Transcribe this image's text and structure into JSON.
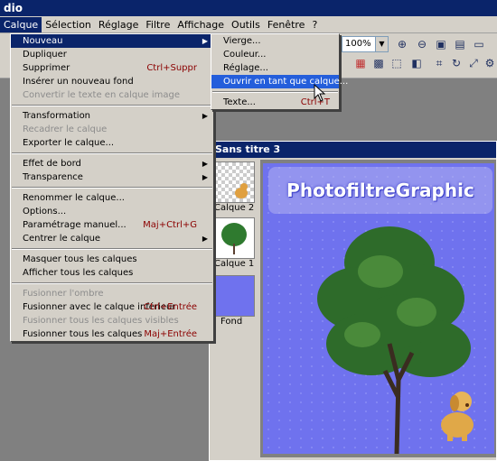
{
  "app": {
    "title_fragment": "dio"
  },
  "menubar": {
    "items": [
      "Calque",
      "Sélection",
      "Réglage",
      "Filtre",
      "Affichage",
      "Outils",
      "Fenêtre",
      "?"
    ],
    "active": "Calque"
  },
  "toolbar": {
    "zoom_value": "100%",
    "icons": [
      "zoom-in-icon",
      "zoom-out-icon",
      "fit-window-icon",
      "actual-size-icon",
      "fullscreen-icon",
      "color-palette-icon",
      "image-icon",
      "selection-icon",
      "layer-icon",
      "crop-icon",
      "rotate-icon",
      "resize-icon",
      "script-icon"
    ]
  },
  "calque_menu": [
    {
      "label": "Nouveau",
      "highlight": true,
      "submenu": true
    },
    {
      "label": "Dupliquer"
    },
    {
      "label": "Supprimer",
      "shortcut": "Ctrl+Suppr"
    },
    {
      "label": "Insérer un nouveau fond"
    },
    {
      "label": "Convertir le texte en calque image",
      "disabled": true
    },
    {
      "sep": true
    },
    {
      "label": "Transformation",
      "submenu": true
    },
    {
      "label": "Recadrer le calque",
      "disabled": true
    },
    {
      "label": "Exporter le calque..."
    },
    {
      "sep": true
    },
    {
      "label": "Effet de bord",
      "submenu": true
    },
    {
      "label": "Transparence",
      "submenu": true
    },
    {
      "sep": true
    },
    {
      "label": "Renommer le calque..."
    },
    {
      "label": "Options..."
    },
    {
      "label": "Paramétrage manuel...",
      "shortcut": "Maj+Ctrl+G"
    },
    {
      "label": "Centrer le calque",
      "submenu": true
    },
    {
      "sep": true
    },
    {
      "label": "Masquer tous les calques"
    },
    {
      "label": "Afficher tous les calques"
    },
    {
      "sep": true
    },
    {
      "label": "Fusionner l'ombre",
      "disabled": true
    },
    {
      "label": "Fusionner avec le calque inférieur",
      "shortcut": "Ctrl+Entrée"
    },
    {
      "label": "Fusionner tous les calques visibles",
      "disabled": true
    },
    {
      "label": "Fusionner tous les calques",
      "shortcut": "Maj+Entrée"
    }
  ],
  "nouveau_submenu": [
    {
      "label": "Vierge..."
    },
    {
      "label": "Couleur..."
    },
    {
      "label": "Réglage..."
    },
    {
      "label": "Ouvrir en tant que calque...",
      "highlight": true
    },
    {
      "sep": true
    },
    {
      "label": "Texte...",
      "shortcut": "Ctrl+T"
    }
  ],
  "document": {
    "title": "Sans titre 3",
    "layers": [
      {
        "label": "Calque 2"
      },
      {
        "label": "Calque 1"
      },
      {
        "label": "Fond"
      }
    ],
    "watermark": "PhotofiltreGraphic"
  },
  "colors": {
    "title_bar": "#0a246a",
    "menu_highlight": "#0a246a",
    "submenu_highlight": "#245edb",
    "canvas_bg": "#6f72ee"
  }
}
